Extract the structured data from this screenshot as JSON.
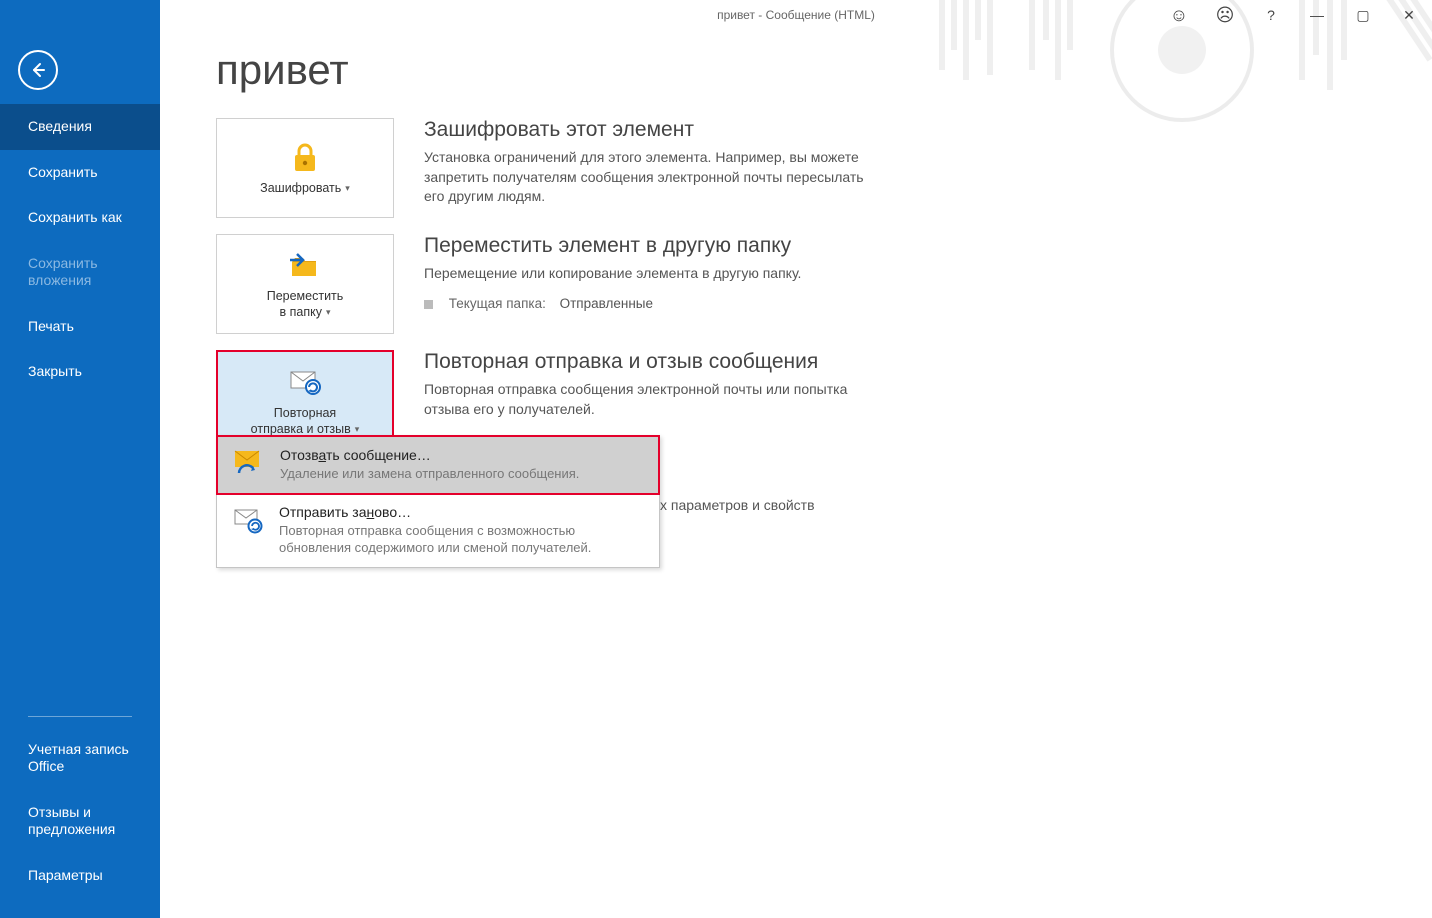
{
  "window": {
    "title": "привет  -  Сообщение (HTML)"
  },
  "sidebar": {
    "back": "←",
    "items": [
      {
        "label": "Сведения",
        "active": true
      },
      {
        "label": "Сохранить"
      },
      {
        "label": "Сохранить как"
      },
      {
        "label": "Сохранить вложения",
        "disabled": true
      },
      {
        "label": "Печать"
      },
      {
        "label": "Закрыть"
      }
    ],
    "bottom": [
      {
        "label": "Учетная запись Office"
      },
      {
        "label": "Отзывы и предложения"
      },
      {
        "label": "Параметры"
      }
    ]
  },
  "page": {
    "title": "привет"
  },
  "sections": {
    "encrypt": {
      "button": "Зашифровать",
      "title": "Зашифровать этот элемент",
      "desc": "Установка ограничений для этого элемента. Например, вы можете запретить получателям сообщения электронной почты пересылать его другим людям."
    },
    "move": {
      "button_l1": "Переместить",
      "button_l2": "в папку",
      "title": "Переместить элемент в другую папку",
      "desc": "Перемещение или копирование элемента в другую папку.",
      "cur_folder_label": "Текущая папка:",
      "cur_folder_value": "Отправленные"
    },
    "resend": {
      "button_l1": "Повторная",
      "button_l2": "отправка и отзыв",
      "title": "Повторная отправка и отзыв сообщения",
      "desc": "Повторная отправка сообщения электронной почты или попытка отзыва его у получателей."
    },
    "props_tail": "х параметров и свойств"
  },
  "dropdown": {
    "recall": {
      "title": "Отозвать сообщение…",
      "desc": "Удаление или замена отправленного сообщения."
    },
    "resend": {
      "title": "Отправить заново…",
      "desc": "Повторная отправка сообщения с возможностью обновления содержимого или сменой получателей."
    }
  }
}
